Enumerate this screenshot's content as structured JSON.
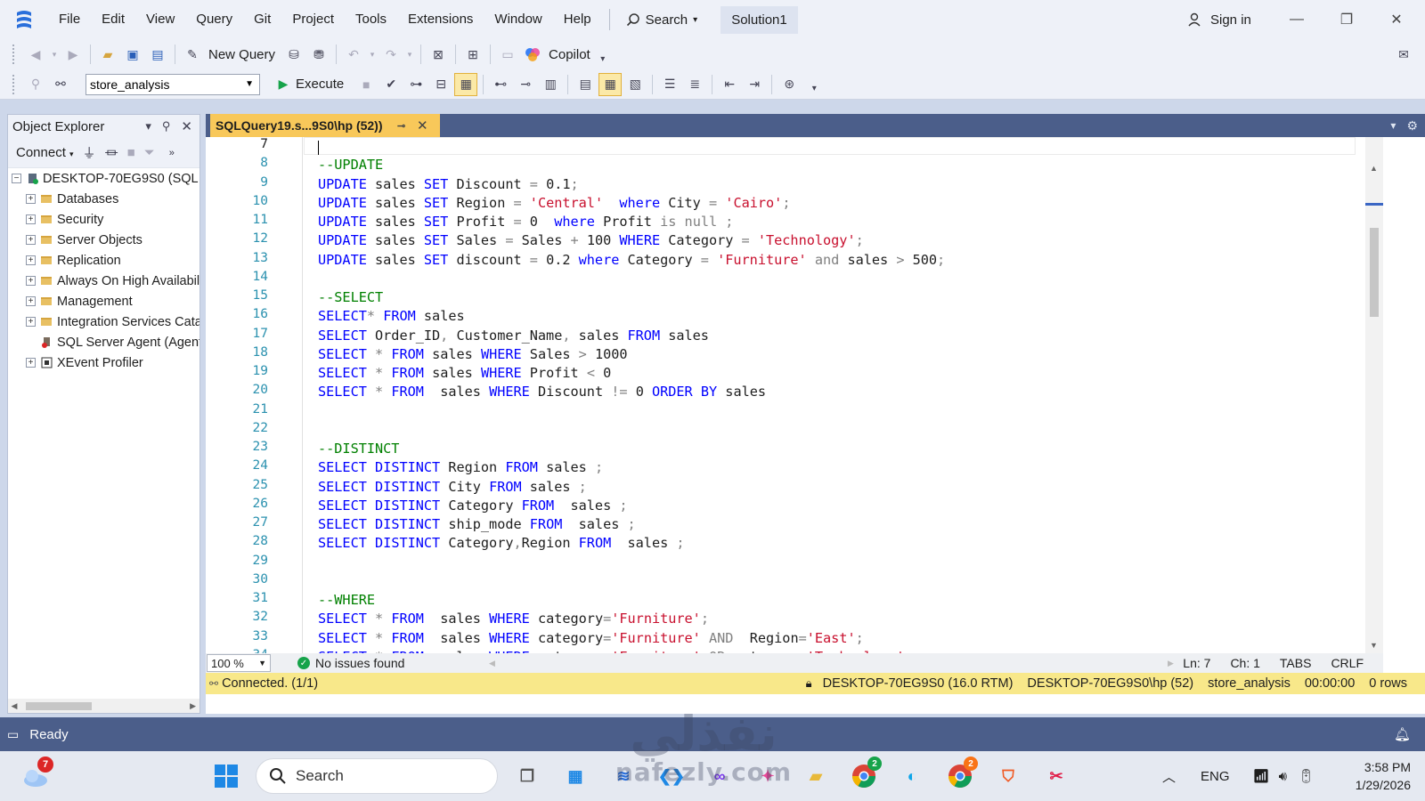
{
  "menubar": {
    "items": [
      "File",
      "Edit",
      "View",
      "Query",
      "Git",
      "Project",
      "Tools",
      "Extensions",
      "Window",
      "Help"
    ],
    "search_label": "Search",
    "solution": "Solution1",
    "signin": "Sign in"
  },
  "toolbar": {
    "new_query": "New Query",
    "copilot": "Copilot",
    "database": "store_analysis",
    "execute": "Execute"
  },
  "object_explorer": {
    "title": "Object Explorer",
    "connect": "Connect",
    "server": "DESKTOP-70EG9S0 (SQL Se",
    "nodes": [
      "Databases",
      "Security",
      "Server Objects",
      "Replication",
      "Always On High Availabil",
      "Management",
      "Integration Services Catal",
      "SQL Server Agent (Agent",
      "XEvent Profiler"
    ]
  },
  "tab": {
    "title": "SQLQuery19.s...9S0\\hp (52))"
  },
  "editor": {
    "line_numbers": [
      "7",
      "8",
      "9",
      "10",
      "11",
      "12",
      "13",
      "14",
      "15",
      "16",
      "17",
      "18",
      "19",
      "20",
      "21",
      "22",
      "23",
      "24",
      "25",
      "26",
      "27",
      "28",
      "29",
      "30",
      "31",
      "32",
      "33",
      "34"
    ]
  },
  "editor_status": {
    "zoom": "100 %",
    "issues": "No issues found",
    "ln": "Ln: 7",
    "ch": "Ch: 1",
    "tabs": "TABS",
    "eol": "CRLF"
  },
  "connection_bar": {
    "status": "Connected. (1/1)",
    "server": "DESKTOP-70EG9S0 (16.0 RTM)",
    "user": "DESKTOP-70EG9S0\\hp (52)",
    "database": "store_analysis",
    "elapsed": "00:00:00",
    "rows": "0 rows"
  },
  "statusbar": {
    "text": "Ready"
  },
  "taskbar": {
    "search": "Search",
    "weather_badge": "7",
    "chrome_badge_1": "2",
    "chrome_badge_2": "2",
    "lang": "ENG",
    "time": "3:58 PM",
    "date": "1/29/2026"
  },
  "watermark": {
    "arabic": "نفذلي",
    "latin": "nafezly.com"
  },
  "colors": {
    "accent": "#4b5e8a",
    "tab_active": "#f8c85a",
    "connection_bar": "#f8e88a",
    "keyword": "#0000ff",
    "string": "#c8102e",
    "comment": "#008000"
  }
}
